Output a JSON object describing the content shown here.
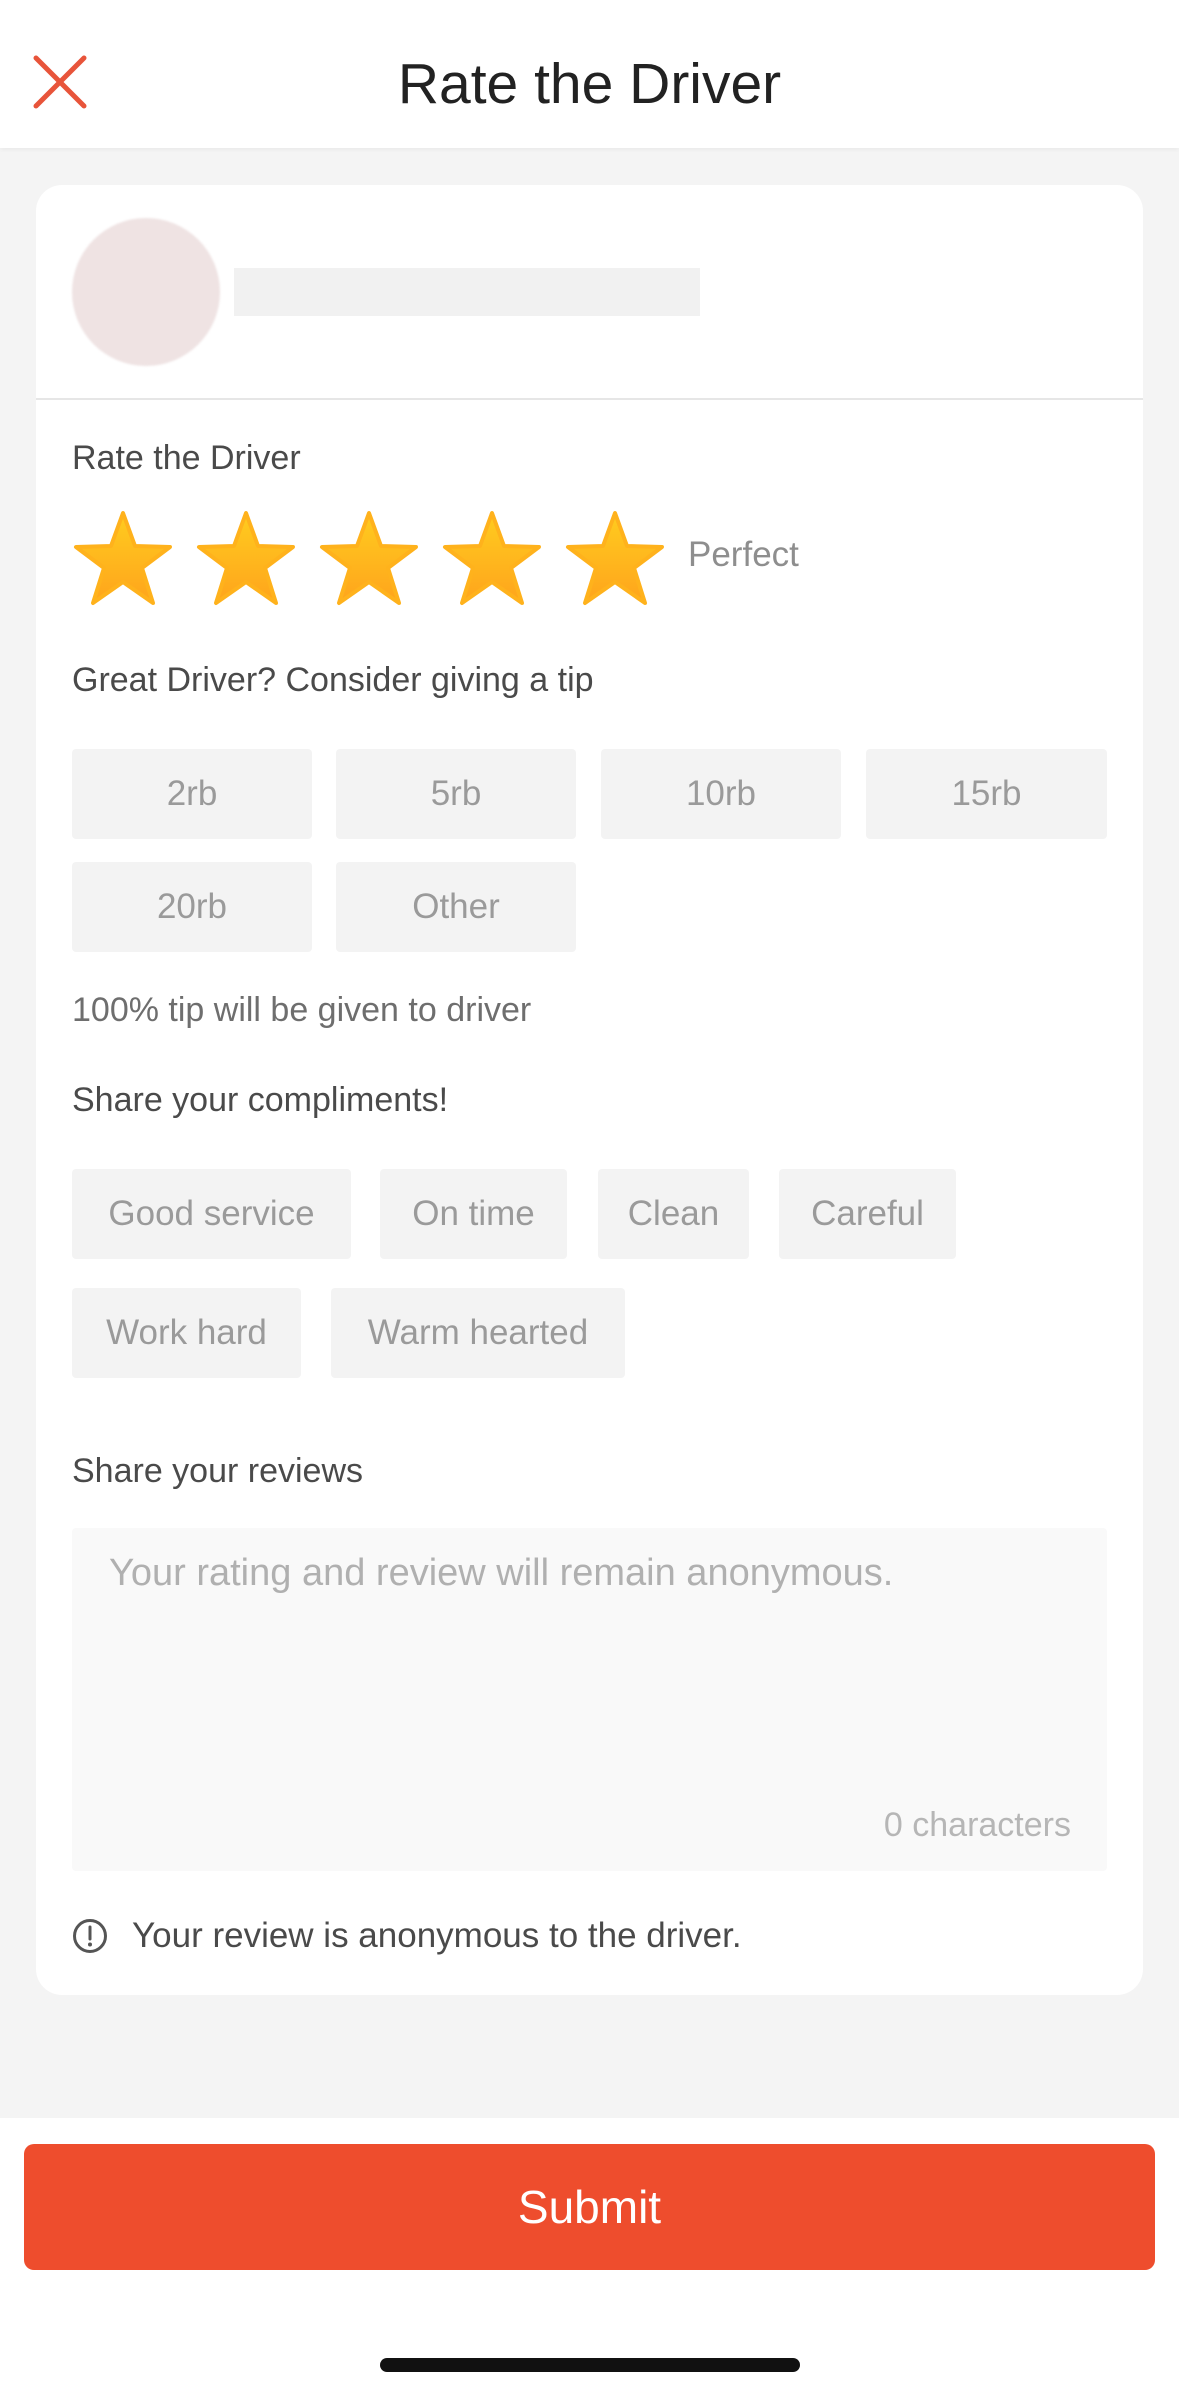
{
  "header": {
    "title": "Rate the Driver",
    "close_icon": "close-icon",
    "accent_color": "#e8543a"
  },
  "driver": {
    "avatar": "avatar-blurred",
    "name_placeholder": ""
  },
  "rating": {
    "label": "Rate the Driver",
    "stars_filled": 5,
    "stars_total": 5,
    "text": "Perfect",
    "star_color": "#ffb81c"
  },
  "tip": {
    "label": "Great Driver? Consider giving a tip",
    "options": [
      "2rb",
      "5rb",
      "10rb",
      "15rb",
      "20rb",
      "Other"
    ],
    "note": "100% tip will be given to driver"
  },
  "compliments": {
    "label": "Share your compliments!",
    "options": [
      "Good service",
      "On time",
      "Clean",
      "Careful",
      "Work hard",
      "Warm hearted"
    ]
  },
  "review": {
    "label": "Share your reviews",
    "placeholder": "Your rating and review will remain anonymous.",
    "char_count": "0 characters",
    "info_icon": "info-icon",
    "info_text": "Your review is anonymous to the driver."
  },
  "footer": {
    "submit_label": "Submit",
    "submit_color": "#ee4d2d"
  }
}
